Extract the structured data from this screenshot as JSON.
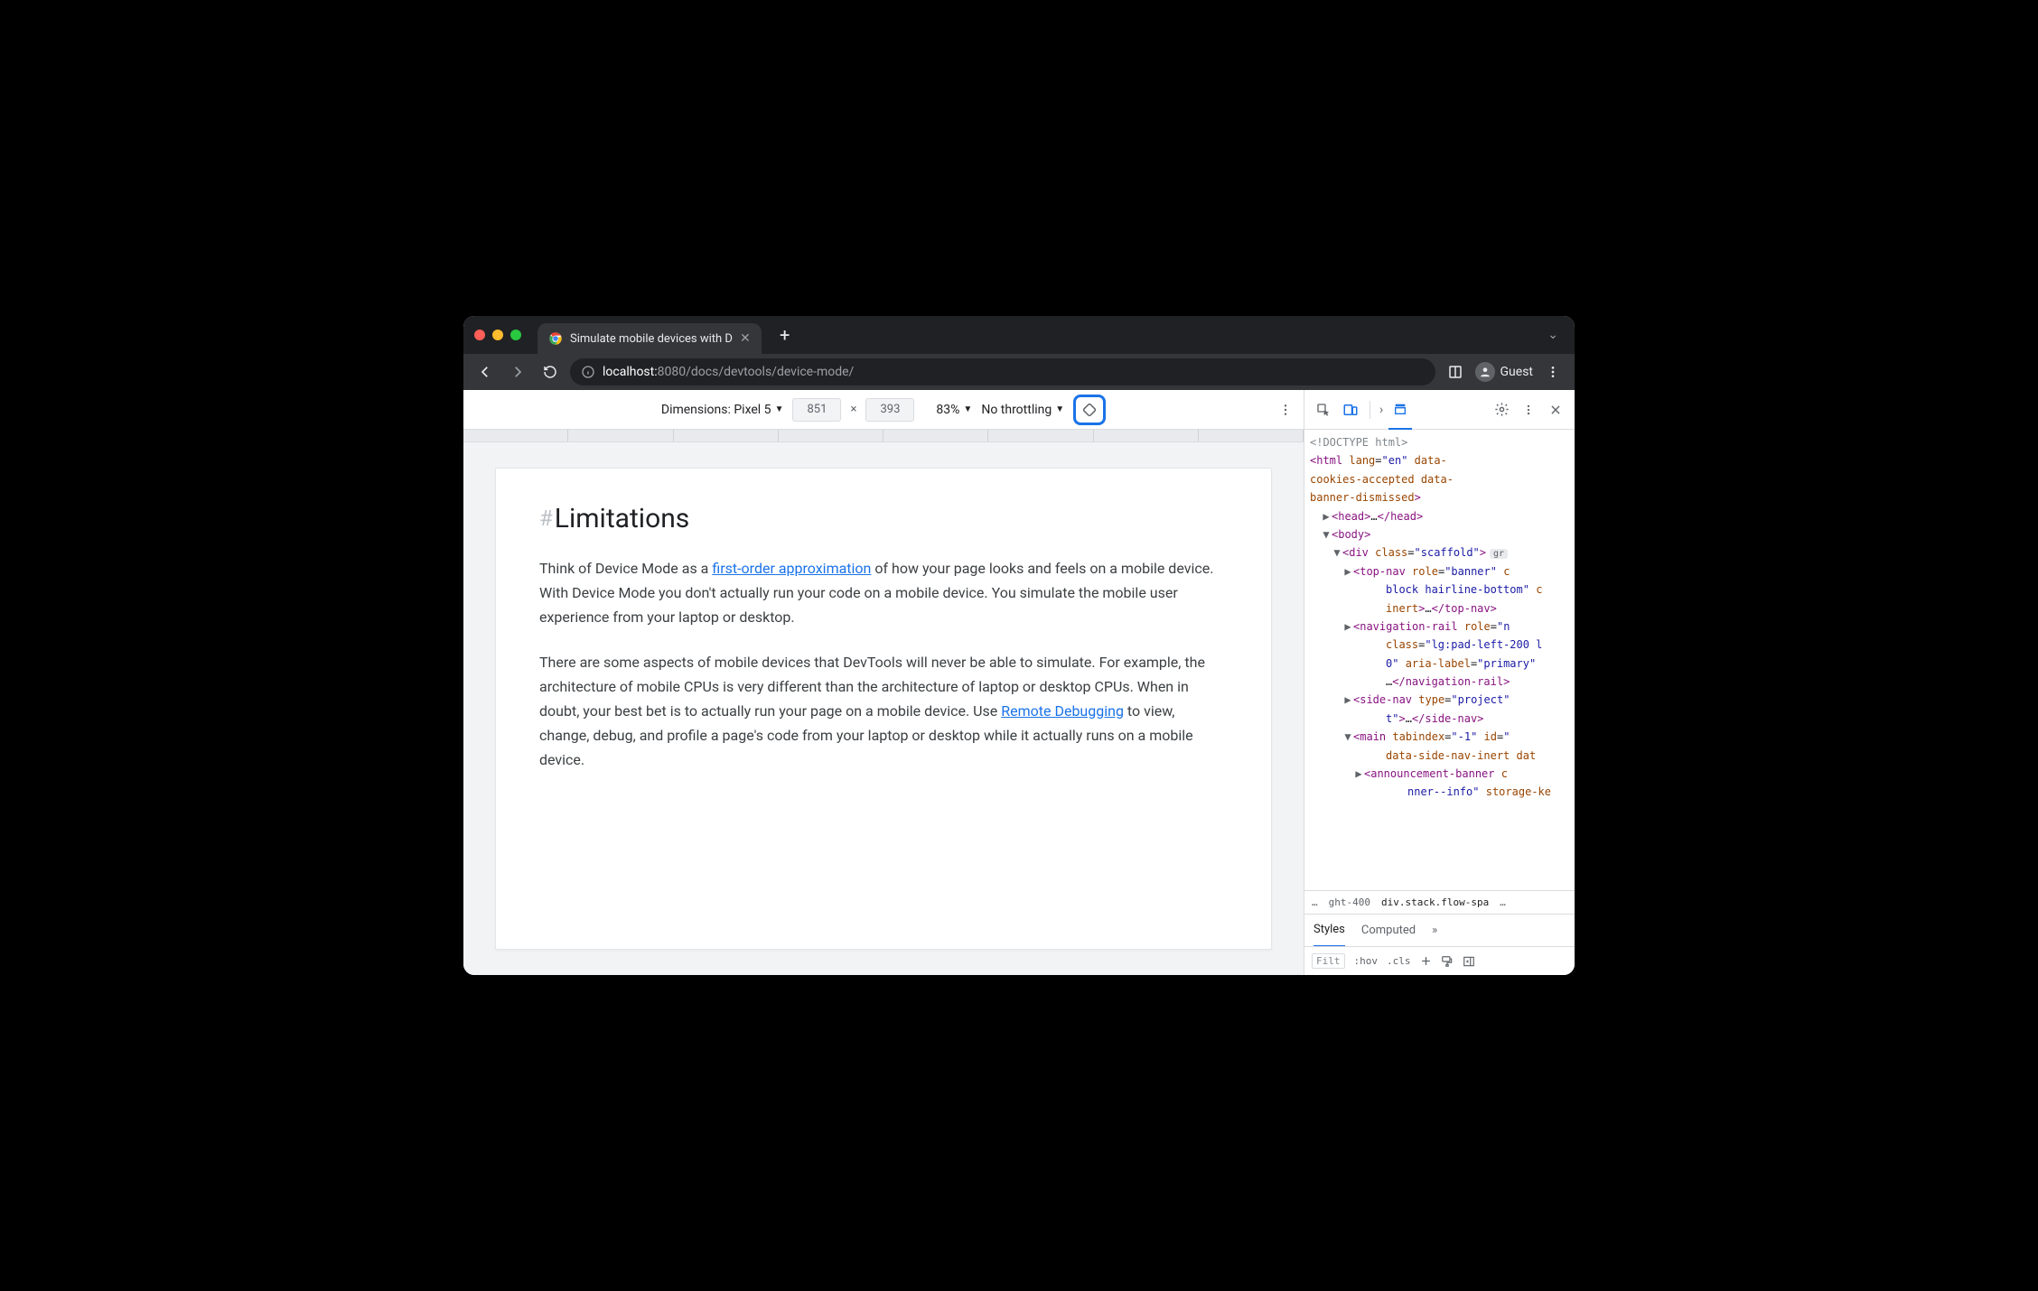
{
  "chrome": {
    "tab_title": "Simulate mobile devices with D",
    "address": {
      "host_dim": "localhost:",
      "host": "8080",
      "path": "/docs/devtools/device-mode/"
    },
    "guest_label": "Guest"
  },
  "device_toolbar": {
    "dimensions_label": "Dimensions: Pixel 5",
    "width": "851",
    "height": "393",
    "zoom": "83%",
    "throttling": "No throttling"
  },
  "page": {
    "heading": "Limitations",
    "p1_a": "Think of Device Mode as a ",
    "p1_link": "first-order approximation",
    "p1_b": " of how your page looks and feels on a mobile device. With Device Mode you don't actually run your code on a mobile device. You simulate the mobile user experience from your laptop or desktop.",
    "p2_a": "There are some aspects of mobile devices that DevTools will never be able to simulate. For example, the architecture of mobile CPUs is very different than the architecture of laptop or desktop CPUs. When in doubt, your best bet is to actually run your page on a mobile device. Use ",
    "p2_link": "Remote Debugging",
    "p2_b": " to view, change, debug, and profile a page's code from your laptop or desktop while it actually runs on a mobile device."
  },
  "dom": {
    "doctype": "<!DOCTYPE html>",
    "html_open": "<html lang=\"en\" data-cookies-accepted data-banner-dismissed>",
    "head": "<head>…</head>",
    "body_open": "<body>",
    "div_scaffold": "<div class=\"scaffold\">",
    "scaffold_pill": "gr",
    "topnav": "<top-nav role=\"banner\" c block hairline-bottom\" c inert>…</top-nav>",
    "navrail": "<navigation-rail role=\"n class=\"lg:pad-left-200 l 0\" aria-label=\"primary\" …</navigation-rail>",
    "sidenav": "<side-nav type=\"project\" t\">…</side-nav>",
    "main": "<main tabindex=\"-1\" id=\" data-side-nav-inert data",
    "announce": "<announcement-banner c nner--info\" storage-ke"
  },
  "breadcrumbs": {
    "left_trunc": "…",
    "seg1": "ght-400",
    "seg2": "div.stack.flow-spa",
    "right_trunc": "…"
  },
  "styles": {
    "tab_styles": "Styles",
    "tab_computed": "Computed",
    "more": "»",
    "filter": "Filt",
    "hov": ":hov",
    "cls": ".cls"
  }
}
